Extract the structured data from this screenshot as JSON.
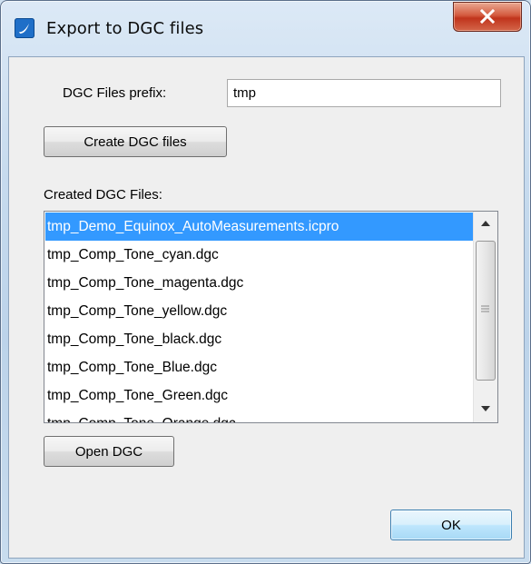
{
  "window": {
    "title": "Export to DGC files",
    "app_icon": "app-logo-icon",
    "close_icon": "close-icon"
  },
  "form": {
    "prefix_label": "DGC Files prefix:",
    "prefix_value": "tmp",
    "create_button": "Create DGC files",
    "created_label": "Created DGC Files:",
    "open_button": "Open DGC",
    "ok_button": "OK"
  },
  "files": [
    "tmp_Demo_Equinox_AutoMeasurements.icpro",
    "tmp_Comp_Tone_cyan.dgc",
    "tmp_Comp_Tone_magenta.dgc",
    "tmp_Comp_Tone_yellow.dgc",
    "tmp_Comp_Tone_black.dgc",
    "tmp_Comp_Tone_Blue.dgc",
    "tmp_Comp_Tone_Green.dgc",
    "tmp_Comp_Tone_Orange.dgc"
  ],
  "selected_index": 0,
  "colors": {
    "selection": "#3399ff",
    "close_button": "#c7432a",
    "ok_button_border": "#3c7fb1"
  }
}
